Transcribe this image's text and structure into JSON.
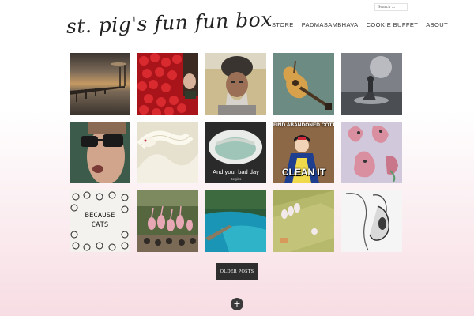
{
  "site": {
    "title": "st. pig's fun fun box"
  },
  "search": {
    "placeholder": "Search ..."
  },
  "nav": [
    {
      "label": "STORE"
    },
    {
      "label": "PADMASAMBHAVA"
    },
    {
      "label": "COOKIE BUFFET"
    },
    {
      "label": "ABOUT"
    }
  ],
  "posts": [
    {
      "icon": "bridge-sunset-image"
    },
    {
      "icon": "red-roses-image"
    },
    {
      "icon": "old-man-turban-image"
    },
    {
      "icon": "guitar-image"
    },
    {
      "icon": "moon-girl-image"
    },
    {
      "icon": "man-sunglasses-image"
    },
    {
      "icon": "white-snake-image"
    },
    {
      "icon": "bathtub-image",
      "caption": "And your bad day",
      "subcaption": "Begins"
    },
    {
      "icon": "snow-white-meme-image",
      "top_text": "FIND ABANDONED COTTAGE",
      "bottom_text": "CLEAN IT"
    },
    {
      "icon": "pink-creatures-drawing-image"
    },
    {
      "icon": "because-cats-image",
      "caption": "BECAUSE CATS"
    },
    {
      "icon": "flamingos-image"
    },
    {
      "icon": "blue-lake-image"
    },
    {
      "icon": "green-pool-table-image"
    },
    {
      "icon": "pencil-sketch-image"
    }
  ],
  "pagination": {
    "older_label": "OLDER POSTS"
  },
  "footer": {
    "more_icon": "plus-icon",
    "more_label": "+"
  },
  "colors": {
    "button_bg": "#2e2e2e",
    "background_bottom": "#f7dde3"
  }
}
